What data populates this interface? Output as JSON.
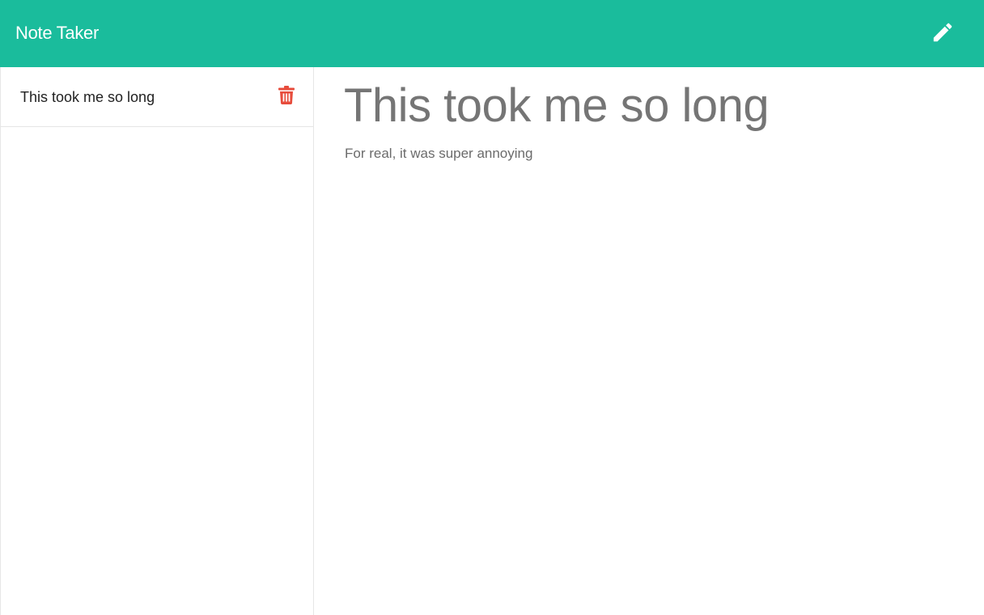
{
  "app": {
    "title": "Note Taker"
  },
  "toolbar": {
    "new_note_icon": "pencil-icon"
  },
  "sidebar": {
    "notes": [
      {
        "title": "This took me so long",
        "delete_icon": "trash-icon"
      }
    ]
  },
  "editor": {
    "title": "This took me so long",
    "text": "For real, it was super annoying"
  },
  "colors": {
    "accent": "#1abc9c",
    "delete": "#e74c3c",
    "header_text": "#ffffff",
    "note_title": "#757575"
  }
}
